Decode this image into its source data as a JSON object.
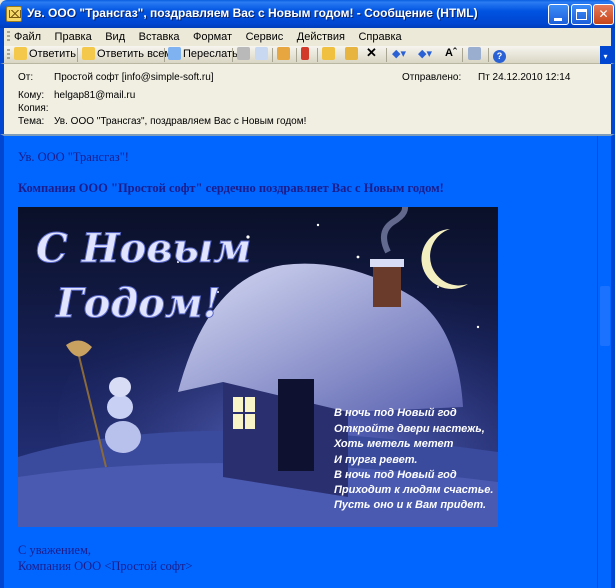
{
  "window": {
    "title": "Ув. ООО \"Трансгаз\", поздравляем Вас с Новым годом! - Сообщение (HTML)",
    "min_label": "_",
    "max_label": "□",
    "close_label": "✕"
  },
  "menu": {
    "items": [
      "Файл",
      "Правка",
      "Вид",
      "Вставка",
      "Формат",
      "Сервис",
      "Действия",
      "Справка"
    ]
  },
  "toolbar": {
    "reply": "Ответить",
    "reply_all": "Ответить всем",
    "forward": "Переслать"
  },
  "header": {
    "from_label": "От:",
    "from_value": "Простой софт [info@simple-soft.ru]",
    "to_label": "Кому:",
    "to_value": "helgap81@mail.ru",
    "cc_label": "Копия:",
    "cc_value": "",
    "subject_label": "Тема:",
    "subject_value": "Ув. ООО \"Трансгаз\", поздравляем Вас с Новым годом!",
    "sent_label": "Отправлено:",
    "sent_value": "Пт 24.12.2010 12:14"
  },
  "body": {
    "greeting": "Ув. ООО \"Трансгаз\"!",
    "congrats": "Компания ООО \"Простой софт\" сердечно поздравляет Вас с Новым годом!",
    "card_title_line1": "С Новым",
    "card_title_line2": "Годом!",
    "poem": [
      "В ночь под Новый год",
      "Откройте двери настежь,",
      "Хоть метель метет",
      "И пурга ревет.",
      "В ночь под Новый год",
      "Приходит к людям счастье.",
      "Пусть оно и к Вам придет."
    ],
    "signoff": "С уважением,",
    "signoff_company": "Компания ООО <Простой софт>"
  },
  "colors": {
    "body_bg": "#0066FF",
    "titlebar": "#0053E1",
    "text": "#1C1C8A"
  }
}
